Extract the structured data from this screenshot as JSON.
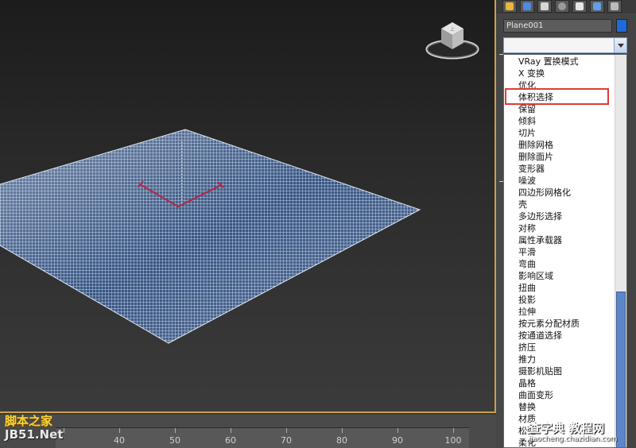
{
  "panel": {
    "object_name": "Plane001",
    "object_color": "#1f6ad8",
    "dropdown_value": ""
  },
  "modifier_list": {
    "items": [
      "VRay 置换模式",
      "X 变换",
      "优化",
      "体积选择",
      "保留",
      "倾斜",
      "切片",
      "删除网格",
      "删除面片",
      "变形器",
      "噪波",
      "四边形网格化",
      "壳",
      "多边形选择",
      "对称",
      "属性承载器",
      "平滑",
      "弯曲",
      "影响区域",
      "扭曲",
      "投影",
      "拉伸",
      "按元素分配材质",
      "按通道选择",
      "挤压",
      "推力",
      "摄影机贴图",
      "晶格",
      "曲面变形",
      "替换",
      "材质",
      "松弛",
      "柔化"
    ],
    "highlighted_item": "体积选择",
    "highlight_color": "#e13a3a"
  },
  "timeline": {
    "ticks": [
      "40",
      "50",
      "60",
      "70",
      "80",
      "90",
      "100"
    ]
  },
  "watermarks": {
    "left_top": "脚本之家",
    "left_bottom": "JB51.Net",
    "right_top": "查字典 教程网",
    "right_url": "jiaocheng.chazidian.com"
  },
  "icons": {
    "viewcube": "viewcube-icon",
    "dropdown": "chevron-down-icon"
  }
}
